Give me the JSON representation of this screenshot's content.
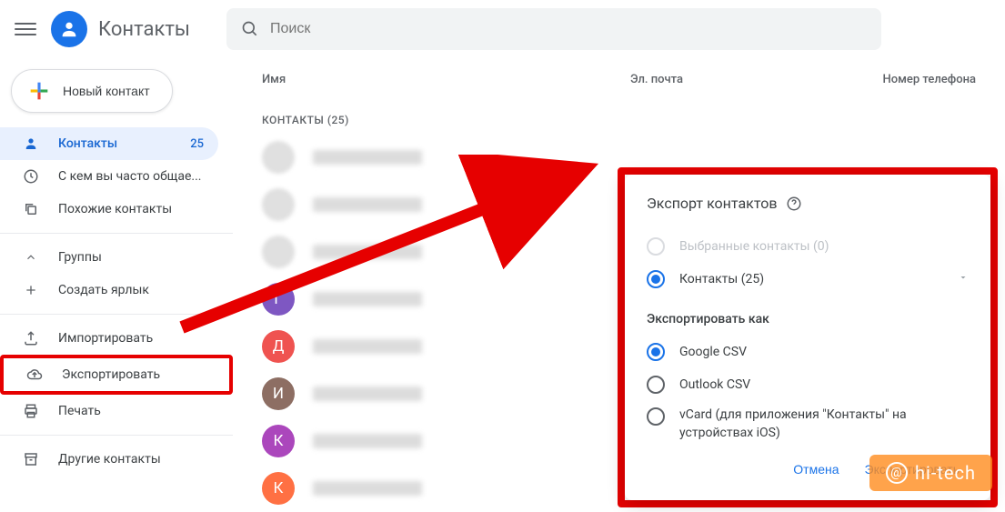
{
  "header": {
    "app_title": "Контакты",
    "search_placeholder": "Поиск"
  },
  "sidebar": {
    "new_contact": "Новый контакт",
    "items": [
      {
        "label": "Контакты",
        "count": "25"
      },
      {
        "label": "С кем вы часто общае..."
      },
      {
        "label": "Похожие контакты"
      }
    ],
    "groups": "Группы",
    "create_label": "Создать ярлык",
    "import": "Импортировать",
    "export": "Экспортировать",
    "print": "Печать",
    "other": "Другие контакты"
  },
  "list": {
    "col_name": "Имя",
    "col_email": "Эл. почта",
    "col_phone": "Номер телефона",
    "section": "КОНТАКТЫ (25)",
    "avatars": [
      {
        "letter": "",
        "color": "#e0e0e0",
        "img": true
      },
      {
        "letter": "",
        "color": "#e0e0e0",
        "img": true
      },
      {
        "letter": "",
        "color": "#e0e0e0",
        "img": true
      },
      {
        "letter": "Г",
        "color": "#7e57c2"
      },
      {
        "letter": "Д",
        "color": "#ef5350"
      },
      {
        "letter": "И",
        "color": "#8d6e63"
      },
      {
        "letter": "К",
        "color": "#ab47bc"
      },
      {
        "letter": "К",
        "color": "#ff7043"
      }
    ]
  },
  "dialog": {
    "title": "Экспорт контактов",
    "opt_selected": "Выбранные контакты (0)",
    "opt_contacts": "Контакты (25)",
    "subtitle": "Экспортировать как",
    "fmt_google": "Google CSV",
    "fmt_outlook": "Outlook CSV",
    "fmt_vcard": "vCard (для приложения \"Контакты\" на устройствах iOS)",
    "cancel": "Отмена",
    "export": "Экспортировать"
  },
  "watermark": "hi-tech"
}
